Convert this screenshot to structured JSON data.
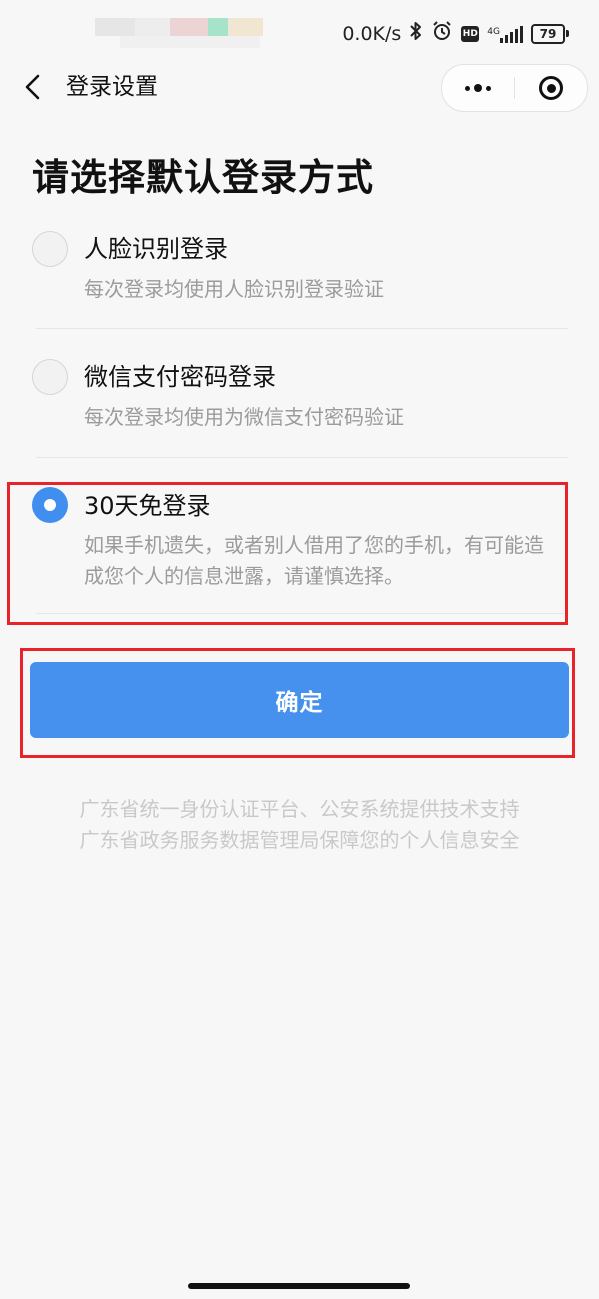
{
  "status_bar": {
    "network_speed": "0.0K/s",
    "hd_label": "HD",
    "network_type": "4G",
    "battery_level": "79"
  },
  "nav": {
    "title": "登录设置"
  },
  "page": {
    "heading": "请选择默认登录方式"
  },
  "options": [
    {
      "title": "人脸识别登录",
      "description": "每次登录均使用人脸识别登录验证",
      "selected": false
    },
    {
      "title": "微信支付密码登录",
      "description": "每次登录均使用为微信支付密码验证",
      "selected": false
    },
    {
      "title": "30天免登录",
      "description": "如果手机遗失，或者别人借用了您的手机，有可能造成您个人的信息泄露，请谨慎选择。",
      "selected": true
    }
  ],
  "confirm_button": {
    "label": "确定"
  },
  "footer": {
    "line1": "广东省统一身份认证平台、公安系统提供技术支持",
    "line2": "广东省政务服务数据管理局保障您的个人信息安全"
  },
  "colors": {
    "accent": "#4691ee",
    "highlight": "#e8232a",
    "background": "#f7f7f7"
  }
}
